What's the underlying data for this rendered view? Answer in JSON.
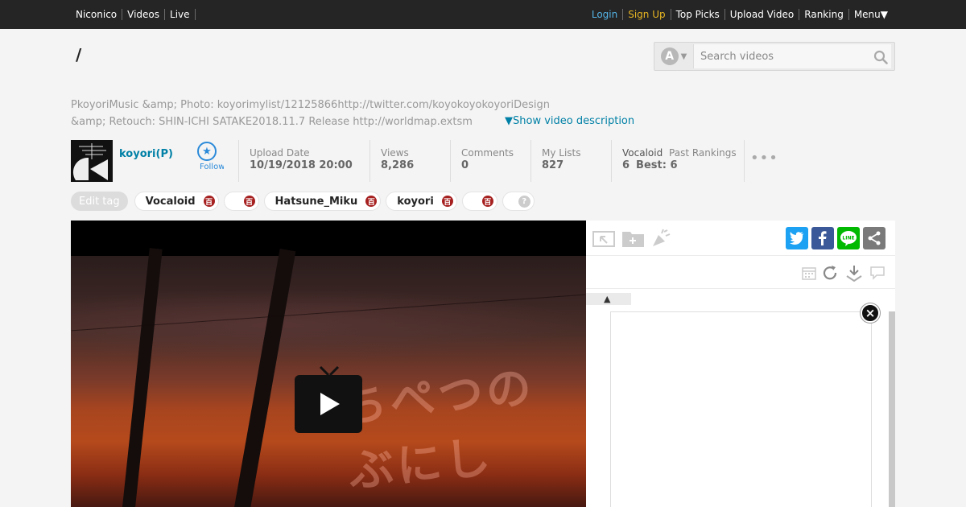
{
  "topbar": {
    "left": [
      "Niconico",
      "Videos",
      "Live"
    ],
    "login": "Login",
    "signup": "Sign Up",
    "right": [
      "Top Picks",
      "Upload Video",
      "Ranking",
      "Menu▼"
    ]
  },
  "video": {
    "title": "/",
    "description_line1": "PkoyoriMusic &amp; Photo: koyorimylist/12125866http://twitter.com/koyokoyokoyoriDesign",
    "description_line2": "&amp; Retouch: SHIN-ICHI SATAKE2018.11.7 Release http://worldmap.extsm",
    "show_description": "▼Show video description"
  },
  "search": {
    "mode_letter": "A",
    "placeholder": "Search videos"
  },
  "owner": {
    "name": "koyori(P)",
    "follow_label": "Follow"
  },
  "stats": {
    "upload_label": "Upload Date",
    "upload_value": "10/19/2018 20:00",
    "views_label": "Views",
    "views_value": "8,286",
    "comments_label": "Comments",
    "comments_value": "0",
    "mylists_label": "My Lists",
    "mylists_value": "827",
    "ranking_category": "Vocaloid",
    "ranking_label": "Past Rankings",
    "ranking_value": "6",
    "ranking_best": "Best: 6",
    "more": "•••"
  },
  "tags": {
    "edit_label": "Edit tag",
    "items": [
      "Vocaloid",
      "",
      "Hatsune_Miku",
      "koyori",
      ""
    ],
    "dict_glyph": "百",
    "help_glyph": "?"
  },
  "side": {
    "sort_arrow": "▲",
    "close_glyph": "×",
    "share": {
      "twitter": "t",
      "facebook": "f",
      "line": "LINE",
      "other": "share"
    }
  },
  "colors": {
    "topbar_bg": "#252525",
    "login": "#54b4e6",
    "signup": "#e6b422",
    "link": "#0080a6",
    "twitter": "#1da1f2",
    "facebook": "#3b5998",
    "line": "#00b900",
    "share": "#7a7a7a"
  }
}
